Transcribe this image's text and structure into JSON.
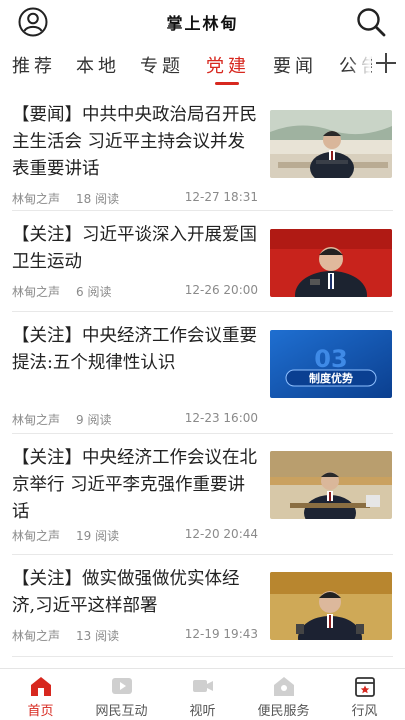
{
  "header": {
    "title": "掌上林甸"
  },
  "tabs": [
    {
      "label": "推荐"
    },
    {
      "label": "本地"
    },
    {
      "label": "专题"
    },
    {
      "label": "党建"
    },
    {
      "label": "要闻"
    },
    {
      "label": "公告"
    }
  ],
  "active_tab": "党建",
  "articles": [
    {
      "headline": "【要闻】中共中央政治局召开民主生活会 习近平主持会议并发表重要讲话",
      "source": "林甸之声",
      "reads": "18 阅读",
      "time": "12-27 18:31"
    },
    {
      "headline": "【关注】习近平谈深入开展爱国卫生运动",
      "source": "林甸之声",
      "reads": "6 阅读",
      "time": "12-26 20:00"
    },
    {
      "headline": "【关注】中央经济工作会议重要提法:五个规律性认识",
      "source": "林甸之声",
      "reads": "9 阅读",
      "time": "12-23 16:00",
      "thumb_text": "制度优势",
      "thumb_number": "03"
    },
    {
      "headline": "【关注】中央经济工作会议在北京举行 习近平李克强作重要讲话",
      "source": "林甸之声",
      "reads": "19 阅读",
      "time": "12-20 20:44"
    },
    {
      "headline": "【关注】做实做强做优实体经济,习近平这样部署",
      "source": "林甸之声",
      "reads": "13 阅读",
      "time": "12-19 19:43"
    }
  ],
  "bottom_nav": [
    {
      "label": "首页",
      "icon": "home-icon",
      "active": true
    },
    {
      "label": "网民互动",
      "icon": "video-play-icon",
      "active": false
    },
    {
      "label": "视听",
      "icon": "camera-icon",
      "active": false
    },
    {
      "label": "便民服务",
      "icon": "house-service-icon",
      "active": false
    },
    {
      "label": "行风",
      "icon": "calendar-star-icon",
      "active": false
    }
  ],
  "colors": {
    "accent": "#d7281f",
    "meta_text": "#8a8a8a",
    "divider": "#e8e8e8"
  }
}
